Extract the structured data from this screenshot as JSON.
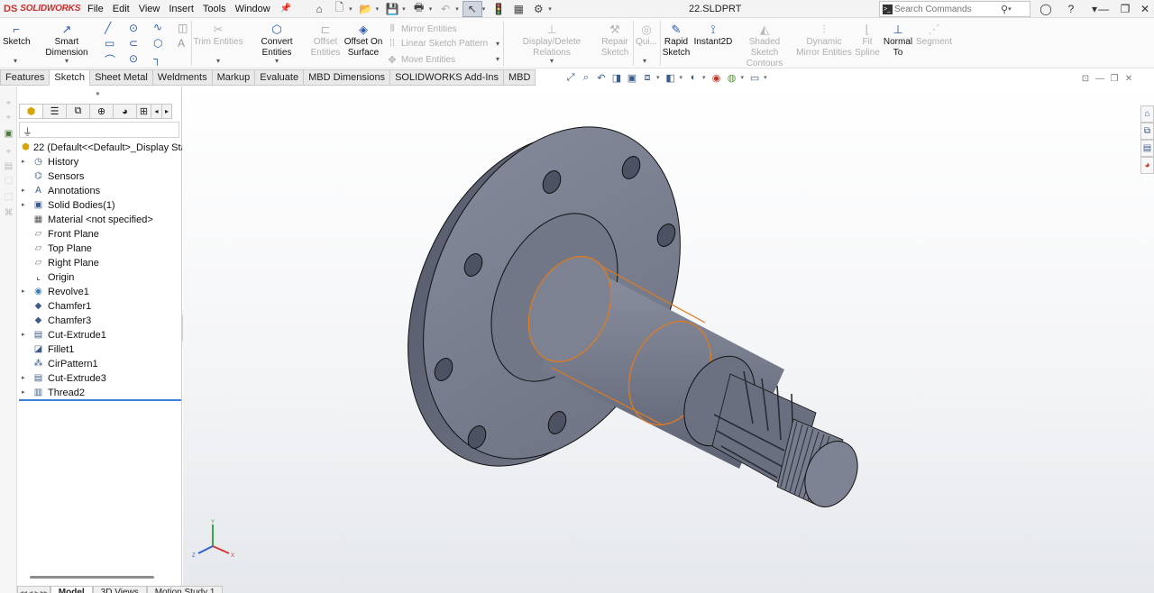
{
  "app": {
    "brand": "SOLIDWORKS",
    "document_title": "22.SLDPRT"
  },
  "menu": [
    "File",
    "Edit",
    "View",
    "Insert",
    "Tools",
    "Window"
  ],
  "search": {
    "placeholder": "Search Commands"
  },
  "command_manager": {
    "sketch": "Sketch",
    "smart_dimension": "Smart Dimension",
    "trim_entities": "Trim Entities",
    "convert_entities": "Convert Entities",
    "offset_entities_1": "Offset",
    "offset_entities_2": "Entities",
    "offset_on_surface_1": "Offset On",
    "offset_on_surface_2": "Surface",
    "mirror_entities": "Mirror Entities",
    "linear_sketch_pattern": "Linear Sketch Pattern",
    "move_entities": "Move Entities",
    "display_delete_relations": "Display/Delete Relations",
    "repair_sketch_1": "Repair",
    "repair_sketch_2": "Sketch",
    "quick_snaps": "Qui...",
    "rapid_sketch_1": "Rapid",
    "rapid_sketch_2": "Sketch",
    "instant2d": "Instant2D",
    "shaded_sketch_1": "Shaded Sketch",
    "shaded_sketch_2": "Contours",
    "dynamic_mirror_1": "Dynamic",
    "dynamic_mirror_2": "Mirror Entities",
    "fit_spline_1": "Fit",
    "fit_spline_2": "Spline",
    "normal_to_1": "Normal",
    "normal_to_2": "To",
    "segment": "Segment"
  },
  "tabs": [
    "Features",
    "Sketch",
    "Sheet Metal",
    "Weldments",
    "Markup",
    "Evaluate",
    "MBD Dimensions",
    "SOLIDWORKS Add-Ins",
    "MBD"
  ],
  "active_tab": "Sketch",
  "feature_tree": {
    "root": "22  (Default<<Default>_Display Stat",
    "items": [
      {
        "label": "History",
        "icon": "history-icon",
        "expandable": true
      },
      {
        "label": "Sensors",
        "icon": "sensors-icon",
        "expandable": false
      },
      {
        "label": "Annotations",
        "icon": "annotations-icon",
        "expandable": true
      },
      {
        "label": "Solid Bodies(1)",
        "icon": "solid-bodies-icon",
        "expandable": true
      },
      {
        "label": "Material <not specified>",
        "icon": "material-icon",
        "expandable": false
      },
      {
        "label": "Front Plane",
        "icon": "plane-icon",
        "expandable": false
      },
      {
        "label": "Top Plane",
        "icon": "plane-icon",
        "expandable": false
      },
      {
        "label": "Right Plane",
        "icon": "plane-icon",
        "expandable": false
      },
      {
        "label": "Origin",
        "icon": "origin-icon",
        "expandable": false
      },
      {
        "label": "Revolve1",
        "icon": "revolve-icon",
        "expandable": true
      },
      {
        "label": "Chamfer1",
        "icon": "chamfer-icon",
        "expandable": false
      },
      {
        "label": "Chamfer3",
        "icon": "chamfer-icon",
        "expandable": false
      },
      {
        "label": "Cut-Extrude1",
        "icon": "cut-extrude-icon",
        "expandable": true
      },
      {
        "label": "Fillet1",
        "icon": "fillet-icon",
        "expandable": false
      },
      {
        "label": "CirPattern1",
        "icon": "circular-pattern-icon",
        "expandable": false
      },
      {
        "label": "Cut-Extrude3",
        "icon": "cut-extrude-icon",
        "expandable": true
      },
      {
        "label": "Thread2",
        "icon": "thread-icon",
        "expandable": true
      }
    ]
  },
  "bottom_tabs": [
    "Model",
    "3D Views",
    "Motion Study 1"
  ],
  "colors": {
    "accent": "#3a7fd1",
    "model_body": "#7a7f8e",
    "selection_edge": "#e07a1f",
    "brand": "#d12b2b"
  }
}
